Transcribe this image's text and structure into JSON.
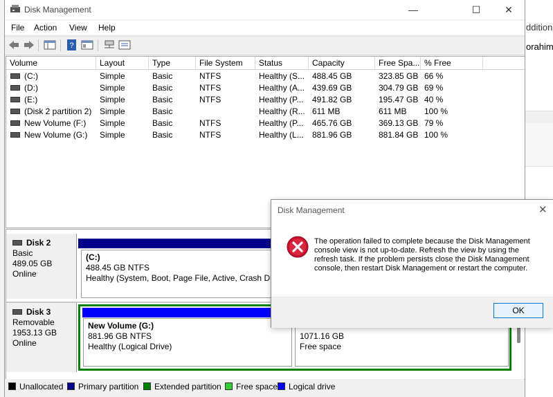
{
  "window": {
    "title": "Disk Management",
    "minimize": "—",
    "maximize": "☐",
    "close": "✕"
  },
  "menu": [
    "File",
    "Action",
    "View",
    "Help"
  ],
  "background": {
    "text1": "dditional",
    "text2": "orahim@"
  },
  "columns": [
    "Volume",
    "Layout",
    "Type",
    "File System",
    "Status",
    "Capacity",
    "Free Spa...",
    "% Free"
  ],
  "volumes": [
    [
      "(C:)",
      "Simple",
      "Basic",
      "NTFS",
      "Healthy (S...",
      "488.45 GB",
      "323.85 GB",
      "66 %"
    ],
    [
      "(D:)",
      "Simple",
      "Basic",
      "NTFS",
      "Healthy (A...",
      "439.69 GB",
      "304.79 GB",
      "69 %"
    ],
    [
      "(E:)",
      "Simple",
      "Basic",
      "NTFS",
      "Healthy (P...",
      "491.82 GB",
      "195.47 GB",
      "40 %"
    ],
    [
      "(Disk 2 partition 2)",
      "Simple",
      "Basic",
      "",
      "Healthy (R...",
      "611 MB",
      "611 MB",
      "100 %"
    ],
    [
      "New Volume (F:)",
      "Simple",
      "Basic",
      "NTFS",
      "Healthy (P...",
      "465.76 GB",
      "369.13 GB",
      "79 %"
    ],
    [
      "New Volume (G:)",
      "Simple",
      "Basic",
      "NTFS",
      "Healthy (L...",
      "881.96 GB",
      "881.84 GB",
      "100 %"
    ]
  ],
  "disks": {
    "disk2": {
      "name": "Disk 2",
      "type": "Basic",
      "size": "489.05 GB",
      "state": "Online",
      "partition": {
        "name": "(C:)",
        "size": "488.45 GB NTFS",
        "status": "Healthy (System, Boot, Page File, Active, Crash Dump"
      }
    },
    "disk3": {
      "name": "Disk 3",
      "type": "Removable",
      "size": "1953.13 GB",
      "state": "Online",
      "partition": {
        "name": "New Volume  (G:)",
        "size": "881.96 GB NTFS",
        "status": "Healthy (Logical Drive)"
      },
      "free": {
        "size": "1071.16 GB",
        "label": "Free space"
      }
    }
  },
  "legend": [
    "Unallocated",
    "Primary partition",
    "Extended partition",
    "Free space",
    "Logical drive"
  ],
  "colors": {
    "unallocated": "#000000",
    "primary": "#00008b",
    "extended": "#008000",
    "free": "#32cd32",
    "logical": "#0000ff"
  },
  "dialog": {
    "title": "Disk Management",
    "message": "The operation failed to complete because the Disk Management console view is not up-to-date.  Refresh the view by using the refresh task. If the problem persists close the Disk Management console, then restart Disk Management or restart the computer.",
    "ok": "OK",
    "close": "✕"
  }
}
